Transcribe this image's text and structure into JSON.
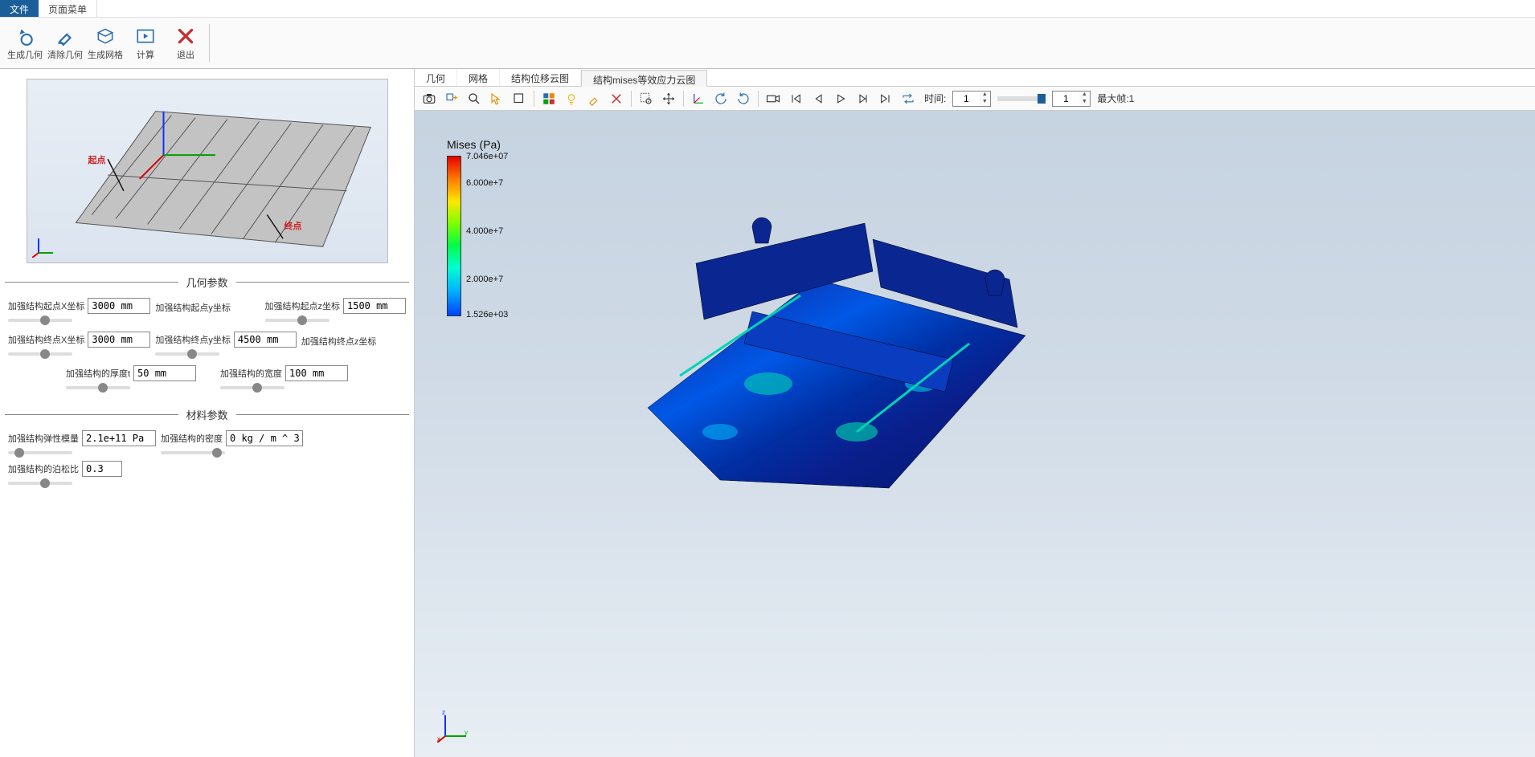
{
  "menu": {
    "file": "文件",
    "page": "页面菜单"
  },
  "ribbon": {
    "gen_geom": "生成几何",
    "clear_geom": "清除几何",
    "gen_mesh": "生成网格",
    "compute": "计算",
    "exit": "退出"
  },
  "geom_preview": {
    "start": "起点",
    "end": "终点"
  },
  "sections": {
    "geom": "几何参数",
    "material": "材料参数"
  },
  "params": {
    "start_x_label": "加强结构起点X坐标",
    "start_x": "3000 mm",
    "start_y_label": "加强结构起点y坐标",
    "start_z_label": "加强结构起点z坐标",
    "start_z": "1500 mm",
    "end_x_label": "加强结构终点X坐标",
    "end_x": "3000 mm",
    "end_y_label": "加强结构终点y坐标",
    "end_y": "4500 mm",
    "end_z_label": "加强结构终点z坐标",
    "thick_label": "加强结构的厚度t",
    "thick": "50 mm",
    "width_label": "加强结构的宽度",
    "width": "100 mm",
    "modulus_label": "加强结构弹性模量",
    "modulus": "2.1e+11 Pa",
    "density_label": "加强结构的密度",
    "density": "0 kg / m ^ 3",
    "poisson_label": "加强结构的泊松比",
    "poisson": "0.3"
  },
  "viewtabs": {
    "geom": "几何",
    "mesh": "网格",
    "disp": "结构位移云图",
    "mises": "结构mises等效应力云图"
  },
  "toolbar": {
    "time_label": "时间:",
    "time_value": "1",
    "frame_value": "1",
    "max_frame": "最大帧:1"
  },
  "legend": {
    "title": "Mises (Pa)",
    "ticks": [
      "7.046e+07",
      "6.000e+7",
      "4.000e+7",
      "2.000e+7",
      "1.526e+03"
    ]
  }
}
